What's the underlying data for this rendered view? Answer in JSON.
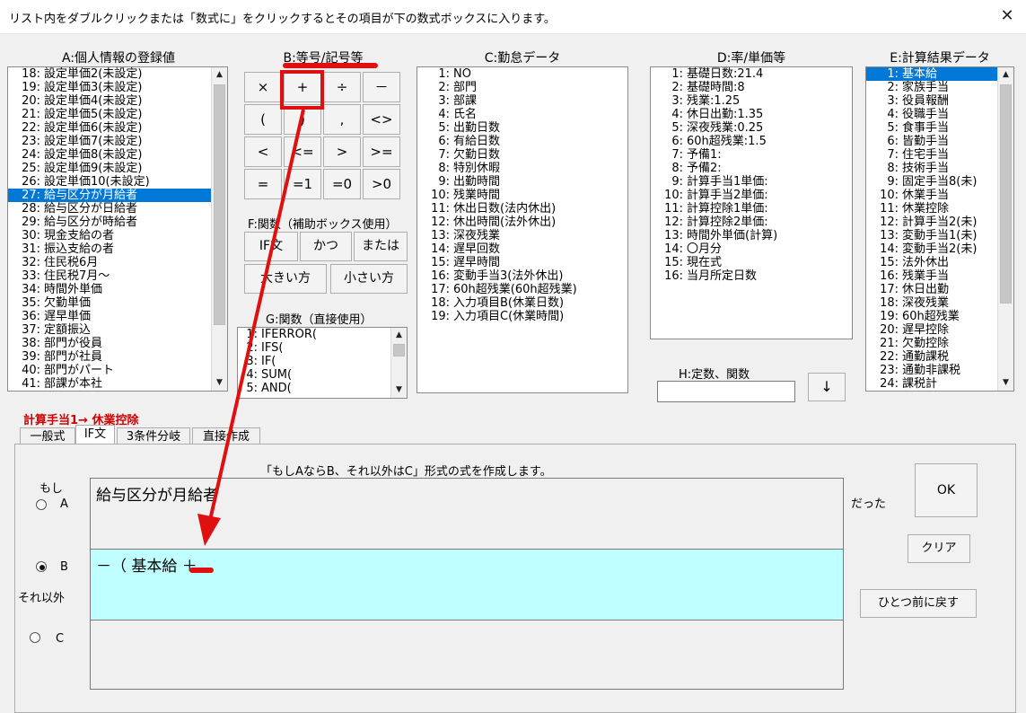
{
  "window": {
    "title": "リスト内をダブルクリックまたは「数式に」をクリックするとその項目が下の数式ボックスに入ります。",
    "close_glyph": "✕"
  },
  "panelA": {
    "title": "A:個人情報の登録値",
    "items": [
      {
        "num": "18:",
        "label": "設定単価2(未設定)"
      },
      {
        "num": "19:",
        "label": "設定単価3(未設定)"
      },
      {
        "num": "20:",
        "label": "設定単価4(未設定)"
      },
      {
        "num": "21:",
        "label": "設定単価5(未設定)"
      },
      {
        "num": "22:",
        "label": "設定単価6(未設定)"
      },
      {
        "num": "23:",
        "label": "設定単価7(未設定)"
      },
      {
        "num": "24:",
        "label": "設定単価8(未設定)"
      },
      {
        "num": "25:",
        "label": "設定単価9(未設定)"
      },
      {
        "num": "26:",
        "label": "設定単価10(未設定)"
      },
      {
        "num": "27:",
        "label": "給与区分が月給者",
        "selected": true
      },
      {
        "num": "28:",
        "label": "給与区分が日給者"
      },
      {
        "num": "29:",
        "label": "給与区分が時給者"
      },
      {
        "num": "30:",
        "label": "現金支給の者"
      },
      {
        "num": "31:",
        "label": "振込支給の者"
      },
      {
        "num": "32:",
        "label": "住民税6月"
      },
      {
        "num": "33:",
        "label": "住民税7月～"
      },
      {
        "num": "34:",
        "label": "時間外単価"
      },
      {
        "num": "35:",
        "label": "欠勤単価"
      },
      {
        "num": "36:",
        "label": "遅早単価"
      },
      {
        "num": "37:",
        "label": "定額振込"
      },
      {
        "num": "38:",
        "label": "部門が役員"
      },
      {
        "num": "39:",
        "label": "部門が社員"
      },
      {
        "num": "40:",
        "label": "部門がパート"
      },
      {
        "num": "41:",
        "label": "部課が本社"
      }
    ]
  },
  "panelB": {
    "title": "B:等号/記号等",
    "buttons": [
      [
        "×",
        "+",
        "÷",
        "－"
      ],
      [
        "(",
        ")",
        ",",
        "<>"
      ],
      [
        "<",
        "<=",
        ">",
        ">="
      ],
      [
        "=",
        "=1",
        "=0",
        ">0"
      ]
    ]
  },
  "panelF": {
    "title": "F:関数（補助ボックス使用）",
    "buttons_row1": [
      "IF文",
      "かつ",
      "または"
    ],
    "buttons_row2": [
      "大きい方",
      "小さい方"
    ]
  },
  "panelG": {
    "title": "G:関数（直接使用）",
    "items": [
      {
        "num": "1:",
        "label": "IFERROR("
      },
      {
        "num": "2:",
        "label": "IFS("
      },
      {
        "num": "3:",
        "label": "IF("
      },
      {
        "num": "4:",
        "label": "SUM("
      },
      {
        "num": "5:",
        "label": "AND("
      }
    ]
  },
  "panelC": {
    "title": "C:勤怠データ",
    "items": [
      {
        "num": "1:",
        "label": "NO"
      },
      {
        "num": "2:",
        "label": "部門"
      },
      {
        "num": "3:",
        "label": "部課"
      },
      {
        "num": "4:",
        "label": "氏名"
      },
      {
        "num": "5:",
        "label": "出勤日数"
      },
      {
        "num": "6:",
        "label": "有給日数"
      },
      {
        "num": "7:",
        "label": "欠勤日数"
      },
      {
        "num": "8:",
        "label": "特別休暇"
      },
      {
        "num": "9:",
        "label": "出勤時間"
      },
      {
        "num": "10:",
        "label": "残業時間"
      },
      {
        "num": "11:",
        "label": "休出日数(法内休出)"
      },
      {
        "num": "12:",
        "label": "休出時間(法外休出)"
      },
      {
        "num": "13:",
        "label": "深夜残業"
      },
      {
        "num": "14:",
        "label": "遅早回数"
      },
      {
        "num": "15:",
        "label": "遅早時間"
      },
      {
        "num": "16:",
        "label": "変動手当3(法外休出)"
      },
      {
        "num": "17:",
        "label": "60h超残業(60h超残業)"
      },
      {
        "num": "18:",
        "label": "入力項目B(休業日数)"
      },
      {
        "num": "19:",
        "label": "入力項目C(休業時間)"
      }
    ]
  },
  "panelD": {
    "title": "D:率/単価等",
    "items": [
      {
        "num": "1:",
        "label": "基礎日数:21.4"
      },
      {
        "num": "2:",
        "label": "基礎時間:8"
      },
      {
        "num": "3:",
        "label": "残業:1.25"
      },
      {
        "num": "4:",
        "label": "休日出勤:1.35"
      },
      {
        "num": "5:",
        "label": "深夜残業:0.25"
      },
      {
        "num": "6:",
        "label": "60h超残業:1.5"
      },
      {
        "num": "7:",
        "label": "予備1:"
      },
      {
        "num": "8:",
        "label": "予備2:"
      },
      {
        "num": "9:",
        "label": "計算手当1単価:"
      },
      {
        "num": "10:",
        "label": "計算手当2単価:"
      },
      {
        "num": "11:",
        "label": "計算控除1単価:"
      },
      {
        "num": "12:",
        "label": "計算控除2単価:"
      },
      {
        "num": "13:",
        "label": "時間外単価(計算)"
      },
      {
        "num": "14:",
        "label": "〇月分"
      },
      {
        "num": "15:",
        "label": "現在式"
      },
      {
        "num": "16:",
        "label": "当月所定日数"
      }
    ]
  },
  "panelH": {
    "title": "H:定数、関数",
    "input_value": "",
    "down_button": "↓"
  },
  "panelE": {
    "title": "E:計算結果データ",
    "items": [
      {
        "num": "1:",
        "label": "基本給",
        "selected": true
      },
      {
        "num": "2:",
        "label": "家族手当"
      },
      {
        "num": "3:",
        "label": "役員報酬"
      },
      {
        "num": "4:",
        "label": "役職手当"
      },
      {
        "num": "5:",
        "label": "食事手当"
      },
      {
        "num": "6:",
        "label": "皆勤手当"
      },
      {
        "num": "7:",
        "label": "住宅手当"
      },
      {
        "num": "8:",
        "label": "技術手当"
      },
      {
        "num": "9:",
        "label": "固定手当8(未)"
      },
      {
        "num": "10:",
        "label": "休業手当"
      },
      {
        "num": "11:",
        "label": "休業控除"
      },
      {
        "num": "12:",
        "label": "計算手当2(未)"
      },
      {
        "num": "13:",
        "label": "変動手当1(未)"
      },
      {
        "num": "14:",
        "label": "変動手当2(未)"
      },
      {
        "num": "15:",
        "label": "法外休出"
      },
      {
        "num": "16:",
        "label": "残業手当"
      },
      {
        "num": "17:",
        "label": "休日出勤"
      },
      {
        "num": "18:",
        "label": "深夜残業"
      },
      {
        "num": "19:",
        "label": "60h超残業"
      },
      {
        "num": "20:",
        "label": "遅早控除"
      },
      {
        "num": "21:",
        "label": "欠勤控除"
      },
      {
        "num": "22:",
        "label": "通勤課税"
      },
      {
        "num": "23:",
        "label": "通勤非課税"
      },
      {
        "num": "24:",
        "label": "課税計"
      }
    ]
  },
  "target_label": "計算手当1→ 休業控除",
  "tabs": [
    "一般式",
    "IF文",
    "3条件分岐",
    "直接作成"
  ],
  "active_tab": 1,
  "if_form": {
    "description": "「もしAならB、それ以外はC」形式の式を作成します。",
    "moshi_label": "もし",
    "radio_a": "A",
    "radio_b": "B",
    "radio_c": "C",
    "sore_igai_label": "それ以外",
    "datta_label": "だった",
    "box_a_value": "給与区分が月給者",
    "box_b_value": "－（ 基本給 ＋",
    "box_c_value": "",
    "selected_radio": "B"
  },
  "buttons": {
    "ok": "OK",
    "clear": "クリア",
    "undo": "ひとつ前に戻す"
  },
  "colors": {
    "selection": "#0078d7",
    "box_b_bg": "#c0ffff",
    "annotation_red": "#e01010",
    "label_red": "#d00000"
  }
}
